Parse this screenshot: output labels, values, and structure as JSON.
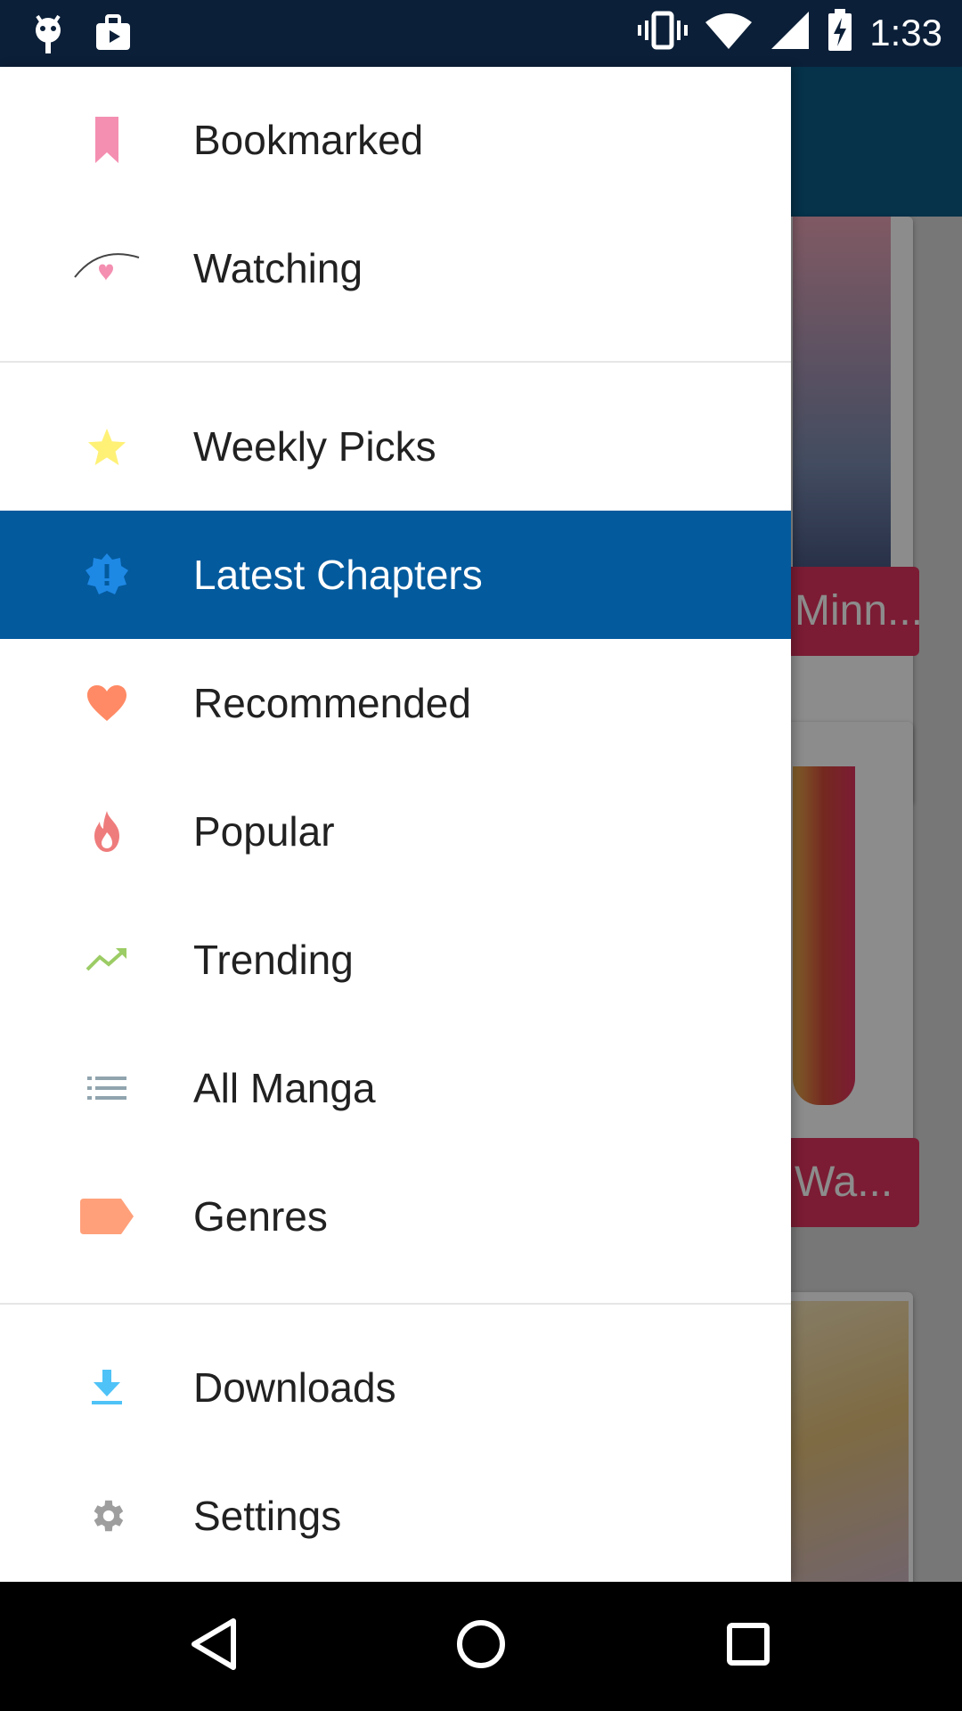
{
  "status_bar": {
    "time": "1:33",
    "icons": [
      "android-debug-icon",
      "media-icon",
      "vibrate-icon",
      "wifi-icon",
      "signal-icon",
      "battery-charging-icon"
    ]
  },
  "background": {
    "card_labels": [
      "Minn...",
      "Wa..."
    ]
  },
  "drawer": {
    "items": [
      {
        "label": "Bookmarked",
        "icon": "bookmark-icon",
        "color": "#f48fb1"
      },
      {
        "label": "Watching",
        "icon": "watching-eye-heart-icon",
        "color": "#f48fb1"
      },
      {
        "label": "Weekly Picks",
        "icon": "star-icon",
        "color": "#fff176"
      },
      {
        "label": "Latest Chapters",
        "icon": "new-badge-icon",
        "color": "#1e88e5"
      },
      {
        "label": "Recommended",
        "icon": "heart-icon",
        "color": "#ff8a65"
      },
      {
        "label": "Popular",
        "icon": "fire-icon",
        "color": "#ef7c7c"
      },
      {
        "label": "Trending",
        "icon": "trending-up-icon",
        "color": "#9ccc65"
      },
      {
        "label": "All Manga",
        "icon": "list-icon",
        "color": "#90a4ae"
      },
      {
        "label": "Genres",
        "icon": "label-tag-icon",
        "color": "#ffa07a"
      },
      {
        "label": "Downloads",
        "icon": "download-icon",
        "color": "#4fc3f7"
      },
      {
        "label": "Settings",
        "icon": "gear-icon",
        "color": "#9e9e9e"
      }
    ],
    "active_item": "Latest Chapters"
  },
  "nav_bar": {
    "buttons": [
      "back-icon",
      "home-icon",
      "recents-icon"
    ]
  }
}
